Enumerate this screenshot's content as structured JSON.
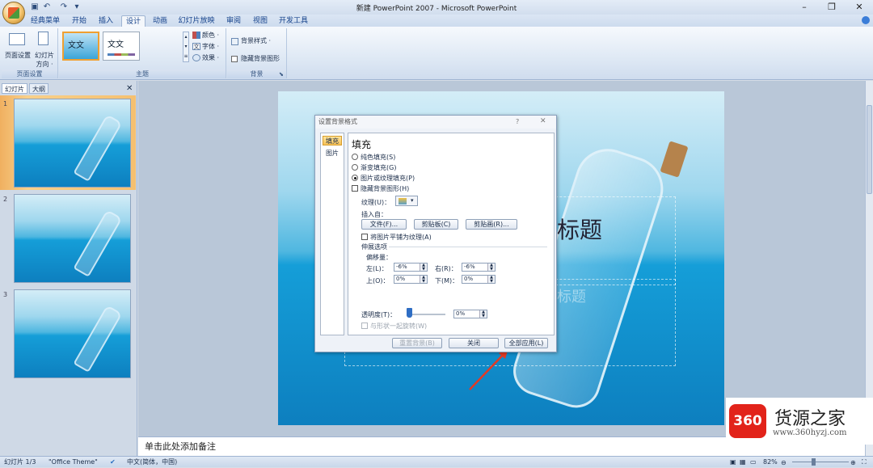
{
  "window": {
    "title": "新建 PowerPoint 2007 - Microsoft PowerPoint",
    "minimize_icon": "minimize-icon",
    "restore_icon": "restore-icon",
    "close_icon": "close-icon"
  },
  "qat": {
    "save": "save-icon",
    "undo": "undo-icon",
    "redo": "redo-icon",
    "more": "qat-more-icon"
  },
  "tabs": [
    {
      "label": "经典菜单"
    },
    {
      "label": "开始"
    },
    {
      "label": "插入"
    },
    {
      "label": "设计"
    },
    {
      "label": "动画"
    },
    {
      "label": "幻灯片放映"
    },
    {
      "label": "审阅"
    },
    {
      "label": "视图"
    },
    {
      "label": "开发工具"
    }
  ],
  "active_tab": "设计",
  "ribbon": {
    "page_setup": {
      "btn1": "页面设置",
      "btn2_line1": "幻灯片",
      "btn2_line2": "方向 ·",
      "group": "页面设置"
    },
    "themes": {
      "thumb1": "文文",
      "thumb2": "文文",
      "colors": "颜色 ·",
      "fonts": "字体 ·",
      "effects": "效果 ·",
      "group": "主题"
    },
    "background": {
      "styles": "背景样式 ·",
      "hide": "隐藏背景图形",
      "group": "背景"
    }
  },
  "left_pane": {
    "tab_slides": "幻灯片",
    "tab_outline": "大纲",
    "close": "✕",
    "slides": [
      {
        "num": "1"
      },
      {
        "num": "2"
      },
      {
        "num": "3"
      }
    ]
  },
  "slide": {
    "title_text": "标题",
    "subtitle_text": "标题"
  },
  "notes": {
    "placeholder": "单击此处添加备注"
  },
  "dialog": {
    "title": "设置背景格式",
    "help": "?",
    "close": "✕",
    "nav": [
      "填充",
      "图片"
    ],
    "heading": "填充",
    "options": {
      "solid": "纯色填充(S)",
      "gradient": "渐变填充(G)",
      "picture": "图片或纹理填充(P)",
      "hide_bg": "隐藏背景图形(H)"
    },
    "texture_label": "纹理(U)：",
    "insert_from": "插入自：",
    "btn_file": "文件(F)...",
    "btn_clipboard": "剪贴板(C)",
    "btn_clipart": "剪贴画(R)...",
    "tile": "将图片平铺为纹理(A)",
    "stretch": "伸展选项",
    "offsets": "偏移量：",
    "left_label": "左(L)：",
    "left_val": "-6%",
    "right_label": "右(R)：",
    "right_val": "-6%",
    "top_label": "上(O)：",
    "top_val": "0%",
    "bottom_label": "下(M)：",
    "bottom_val": "0%",
    "transparency_label": "透明度(T)：",
    "transparency_val": "0%",
    "transparency_level": 0,
    "rotate_with_shape": "与形状一起旋转(W)",
    "btn_reset": "重置背景(B)",
    "btn_close": "关闭",
    "btn_apply_all": "全部应用(L)"
  },
  "status": {
    "slide_info": "幻灯片 1/3",
    "theme": "\"Office Theme\"",
    "language": "中文(简体，中国)",
    "zoom": "82%"
  },
  "watermark": {
    "logo": "360",
    "name": "货源之家",
    "url": "www.360hyzj.com"
  },
  "colors": {
    "accent": "#1c58b5",
    "arrow": "#e23a24",
    "logo_red": "#e2231a"
  }
}
